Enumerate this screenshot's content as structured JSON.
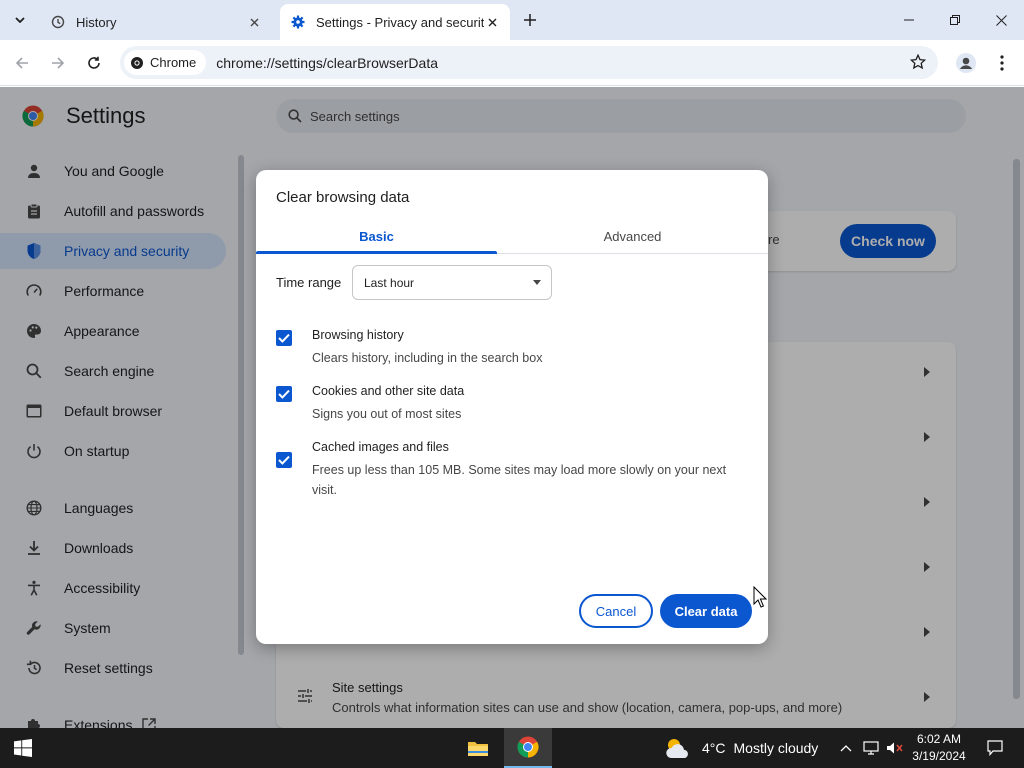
{
  "browser": {
    "tabs": [
      {
        "title": "History",
        "icon": "history-icon"
      },
      {
        "title": "Settings - Privacy and security",
        "icon": "gear-icon"
      }
    ],
    "omnibox": {
      "chip_label": "Chrome",
      "url": "chrome://settings/clearBrowserData"
    }
  },
  "settings": {
    "title": "Settings",
    "search_placeholder": "Search settings",
    "nav": [
      {
        "label": "You and Google",
        "icon": "person-icon"
      },
      {
        "label": "Autofill and passwords",
        "icon": "clipboard-icon"
      },
      {
        "label": "Privacy and security",
        "icon": "shield-icon",
        "active": true
      },
      {
        "label": "Performance",
        "icon": "gauge-icon"
      },
      {
        "label": "Appearance",
        "icon": "palette-icon"
      },
      {
        "label": "Search engine",
        "icon": "search-icon"
      },
      {
        "label": "Default browser",
        "icon": "browser-icon"
      },
      {
        "label": "On startup",
        "icon": "power-icon"
      },
      {
        "label": "Languages",
        "icon": "globe-icon"
      },
      {
        "label": "Downloads",
        "icon": "download-icon"
      },
      {
        "label": "Accessibility",
        "icon": "accessibility-icon"
      },
      {
        "label": "System",
        "icon": "wrench-icon"
      },
      {
        "label": "Reset settings",
        "icon": "reset-icon"
      },
      {
        "label": "Extensions",
        "icon": "puzzle-icon"
      }
    ],
    "safety_check": {
      "peek_text": "re",
      "button": "Check now"
    },
    "site_settings": {
      "title": "Site settings",
      "subtitle": "Controls what information sites can use and show (location, camera, pop-ups, and more)"
    }
  },
  "dialog": {
    "title": "Clear browsing data",
    "tabs": [
      "Basic",
      "Advanced"
    ],
    "time_range_label": "Time range",
    "time_range_value": "Last hour",
    "options": [
      {
        "title": "Browsing history",
        "subtitle": "Clears history, including in the search box",
        "checked": true
      },
      {
        "title": "Cookies and other site data",
        "subtitle": "Signs you out of most sites",
        "checked": true
      },
      {
        "title": "Cached images and files",
        "subtitle": "Frees up less than 105 MB. Some sites may load more slowly on your next visit.",
        "checked": true
      }
    ],
    "cancel": "Cancel",
    "confirm": "Clear data"
  },
  "taskbar": {
    "weather_temp": "4°C",
    "weather_desc": "Mostly cloudy",
    "time": "6:02 AM",
    "date": "3/19/2024"
  },
  "colors": {
    "accent": "#0b57d0",
    "nav_active_bg": "#d3e3fd",
    "page_bg": "#f2f5fb"
  }
}
